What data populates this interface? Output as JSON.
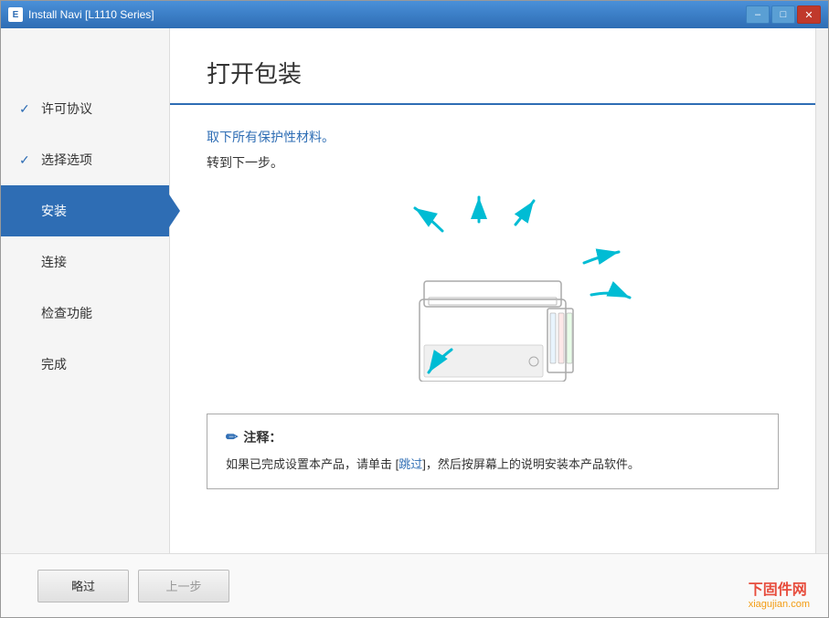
{
  "window": {
    "title": "Install Navi [L1110 Series]",
    "icon_label": "E"
  },
  "titlebar_buttons": {
    "minimize": "–",
    "maximize": "□",
    "close": "✕"
  },
  "sidebar": {
    "items": [
      {
        "id": "license",
        "label": "许可协议",
        "state": "completed"
      },
      {
        "id": "options",
        "label": "选择选项",
        "state": "completed"
      },
      {
        "id": "install",
        "label": "安装",
        "state": "active"
      },
      {
        "id": "connect",
        "label": "连接",
        "state": "normal"
      },
      {
        "id": "check",
        "label": "检查功能",
        "state": "normal"
      },
      {
        "id": "complete",
        "label": "完成",
        "state": "normal"
      }
    ]
  },
  "main": {
    "title": "打开包装",
    "instruction1": "取下所有保护性材料。",
    "instruction2": "转到下一步。",
    "note": {
      "title": "注释：",
      "text": "如果已完成设置本产品，请单击 [跳过]，然后按屏幕上的说明安装本产品软件。",
      "link_text": "跳过"
    }
  },
  "footer": {
    "skip_btn": "略过",
    "prev_btn": "上一步"
  },
  "watermark": {
    "line1": "下固件网",
    "line2": "xiagujian.com"
  }
}
